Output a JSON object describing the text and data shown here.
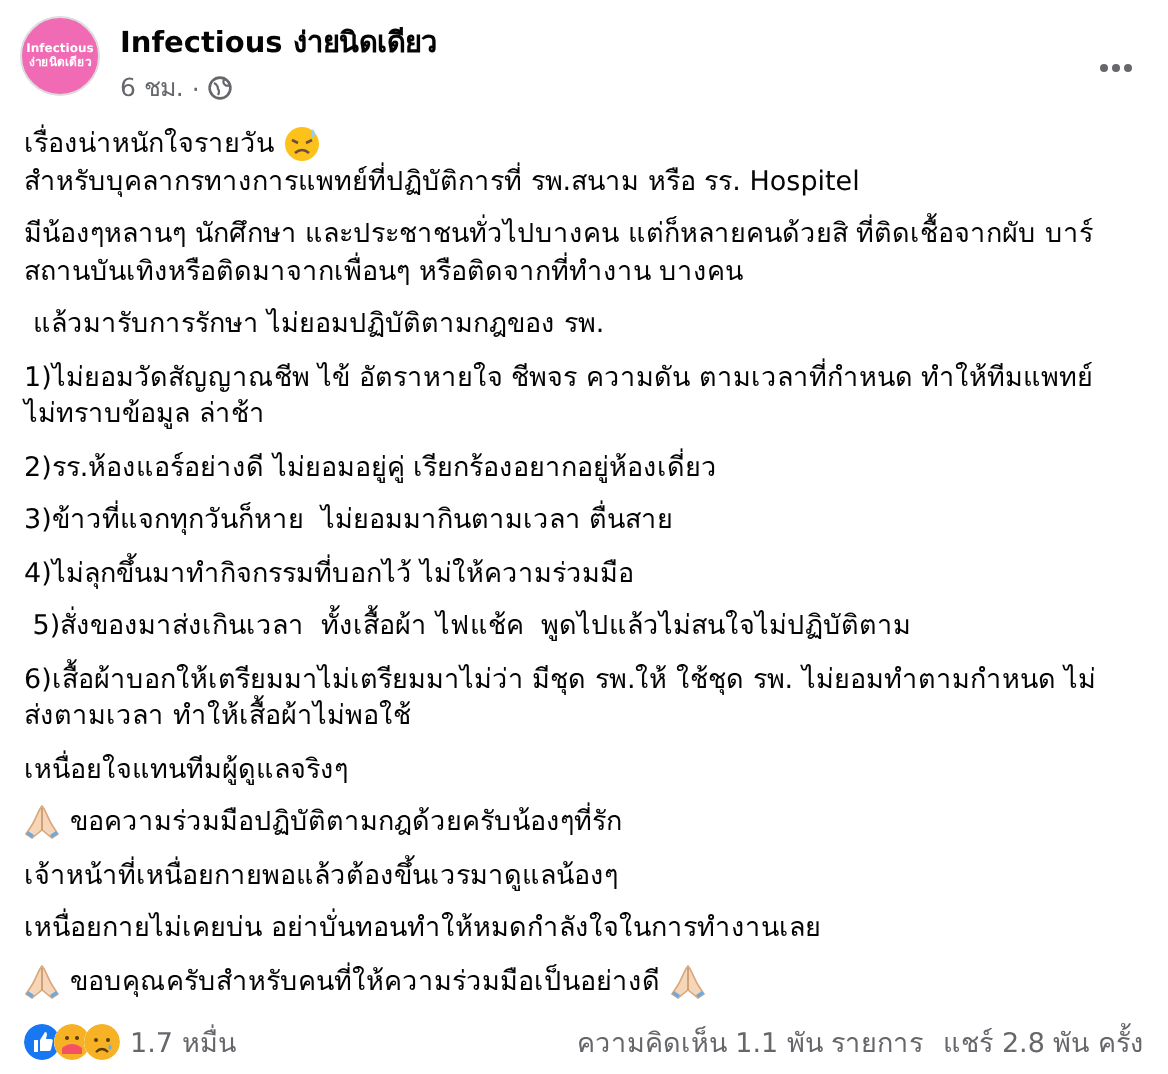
{
  "post": {
    "author": "Infectious ง่ายนิดเดียว",
    "avatar_text": [
      "Infectious",
      "ง่ายนิดเดียว"
    ],
    "time": "6 ชม.",
    "separator": "·"
  },
  "paragraphs": [
    {
      "kind": "sad",
      "lines": [
        "เรื่องน่าหนักใจรายวัน",
        "สำหรับบุคลากรทางการแพทย์ที่ปฏิบัติการที่ รพ.สนาม หรือ รร. Hospitel"
      ]
    },
    {
      "kind": "text",
      "lines": [
        "มีน้องๆหลานๆ นักศึกษา และประชาชนทั่วไปบางคน แต่ก็หลายคนด้วยสิ ที่ติดเชื้อจากผับ บาร์",
        "สถานบันเทิงหรือติดมาจากเพื่อนๆ หรือติดจากที่ทำงาน บางคน"
      ]
    },
    {
      "kind": "text",
      "lines": [
        " แล้วมารับการรักษา ไม่ยอมปฏิบัติตามกฎของ รพ."
      ]
    },
    {
      "kind": "text",
      "lines": [
        "1)ไม่ยอมวัดสัญญาณชีพ ไข้ อัตราหายใจ ชีพจร ความดัน ตามเวลาที่กำหนด ทำให้ทีมแพทย์",
        "ไม่ทราบข้อมูล ล่าช้า"
      ]
    },
    {
      "kind": "text",
      "lines": [
        "2)รร.ห้องแอร์อย่างดี ไม่ยอมอยู่คู่ เรียกร้องอยากอยู่ห้องเดี่ยว"
      ]
    },
    {
      "kind": "text",
      "lines": [
        "3)ข้าวที่แจกทุกวันก็หาย  ไม่ยอมมากินตามเวลา ตื่นสาย"
      ]
    },
    {
      "kind": "text",
      "lines": [
        "4)ไม่ลุกขึ้นมาทำกิจกรรมที่บอกไว้ ไม่ให้ความร่วมมือ"
      ]
    },
    {
      "kind": "text",
      "lines": [
        " 5)สั่งของมาส่งเกินเวลา  ทั้งเสื้อผ้า ไฟแช้ค  พูดไปแล้วไม่สนใจไม่ปฏิบัติตาม"
      ]
    },
    {
      "kind": "text",
      "lines": [
        "6)เสื้อผ้าบอกให้เตรียมมาไม่เตรียมมาไม่ว่า มีชุด รพ.ให้ ใช้ชุด รพ. ไม่ยอมทำตามกำหนด ไม่",
        "ส่งตามเวลา ทำให้เสื้อผ้าไม่พอใช้"
      ]
    },
    {
      "kind": "text",
      "lines": [
        "เหนื่อยใจแทนทีมผู้ดูแลจริงๆ"
      ]
    },
    {
      "kind": "pray",
      "lines": [
        "ขอความร่วมมือปฏิบัติตามกฎด้วยครับน้องๆที่รัก"
      ]
    },
    {
      "kind": "text",
      "lines": [
        "เจ้าหน้าที่เหนื่อยกายพอแล้วต้องขึ้นเวรมาดูแลน้องๆ"
      ]
    },
    {
      "kind": "text",
      "lines": [
        "เหนื่อยกายไม่เคยบ่น อย่าบั่นทอนทำให้หมดกำลังใจในการทำงานเลย"
      ]
    },
    {
      "kind": "pray-both",
      "lines": [
        "ขอบคุณครับสำหรับคนที่ให้ความร่วมมือเป็นอย่างดี"
      ]
    }
  ],
  "footer": {
    "reactions_count": "1.7 หมื่น",
    "comments": "ความคิดเห็น 1.1 พัน รายการ",
    "shares": "แชร์ 2.8 พัน ครั้ง"
  }
}
